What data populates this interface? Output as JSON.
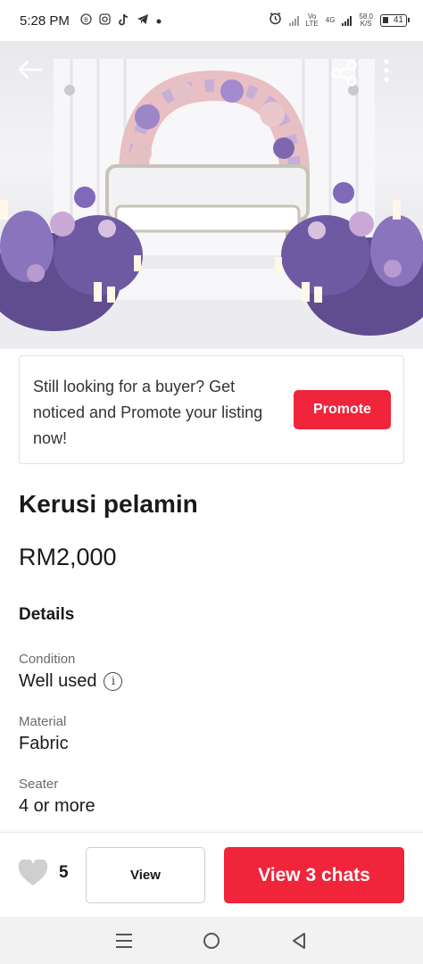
{
  "status_bar": {
    "time": "5:28 PM",
    "left_icons": [
      "b-icon",
      "instagram-icon",
      "tiktok-icon",
      "telegram-icon",
      "dot-icon"
    ],
    "net_line1": "Vo",
    "net_line2": "LTE",
    "net_4g": "4G",
    "speed_value": "58.0",
    "speed_unit": "K/S",
    "battery": "41"
  },
  "hero": {
    "back_icon": "arrow-left-icon",
    "share_icon": "share-icon",
    "more_icon": "more-vertical-icon"
  },
  "promo": {
    "text": "Still looking for a buyer? Get noticed and Promote your listing now!",
    "button_label": "Promote"
  },
  "listing": {
    "title": "Kerusi pelamin",
    "price": "RM2,000",
    "details_heading": "Details",
    "attributes": [
      {
        "label": "Condition",
        "value": "Well used"
      },
      {
        "label": "Material",
        "value": "Fabric"
      },
      {
        "label": "Seater",
        "value": "4 or more"
      }
    ]
  },
  "action_bar": {
    "like_count": "5",
    "view_label": "View",
    "chats_label": "View 3 chats"
  },
  "colors": {
    "accent": "#f0243a",
    "text": "#1a1a1a",
    "muted": "#6b6b6b"
  }
}
